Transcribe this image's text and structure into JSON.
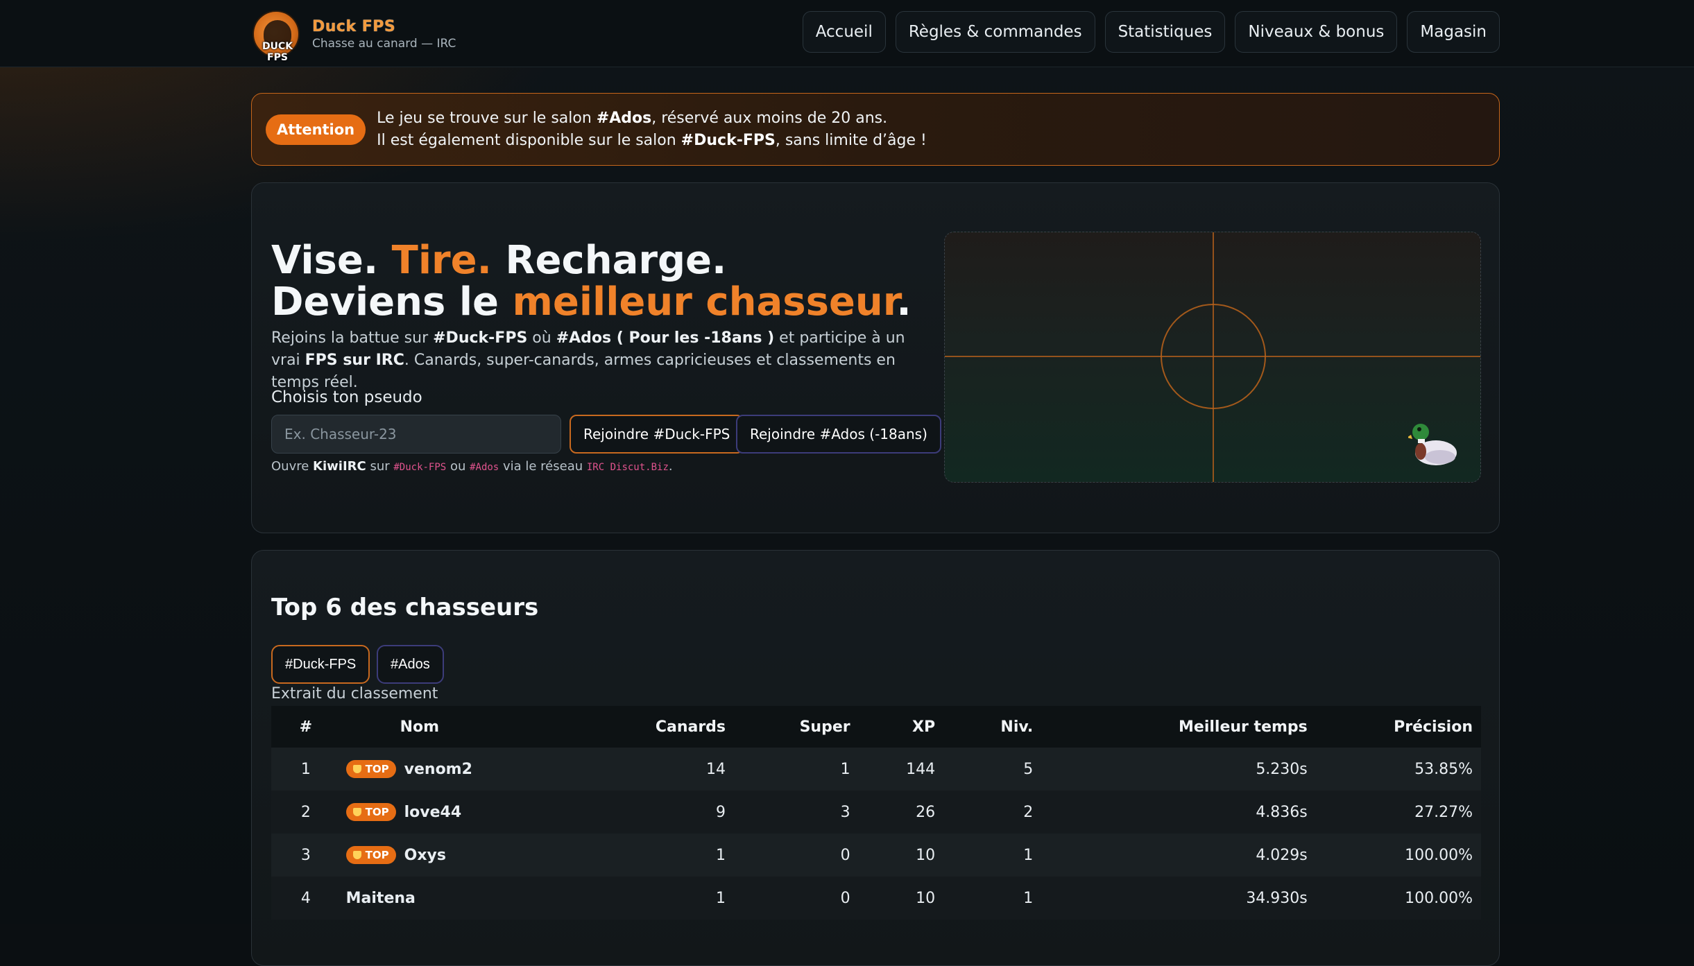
{
  "brand": {
    "logo_text": "DUCK FPS",
    "title": "Duck FPS",
    "subtitle": "Chasse au canard — IRC"
  },
  "nav": [
    {
      "label": "Accueil"
    },
    {
      "label": "Règles & commandes"
    },
    {
      "label": "Statistiques"
    },
    {
      "label": "Niveaux & bonus"
    },
    {
      "label": "Magasin"
    }
  ],
  "alert": {
    "badge": "Attention",
    "line1_pre": "Le jeu se trouve sur le salon ",
    "line1_bold": "#Ados",
    "line1_post": ", réservé aux moins de 20 ans.",
    "line2_pre": "Il est également disponible sur le salon ",
    "line2_bold": "#Duck-FPS",
    "line2_post": ", sans limite d’âge !"
  },
  "hero": {
    "t1": "Vise. ",
    "t1_accent": "Tire.",
    "t1_tail": " Recharge.",
    "t2": "Deviens le ",
    "t2_accent": "meilleur chasseur",
    "t2_tail": ".",
    "desc_1": "Rejoins la battue sur ",
    "desc_b1": "#Duck-FPS",
    "desc_2": " où ",
    "desc_b2": "#Ados ( Pour les -18ans )",
    "desc_3": " et participe à un vrai ",
    "desc_b3": "FPS sur IRC",
    "desc_4": ". Canards, super-canards, armes capricieuses et classements en temps réel.",
    "pseudo_label": "Choisis ton pseudo",
    "pseudo_placeholder": "Ex. Chasseur-23",
    "join_duck": "Rejoindre #Duck-FPS",
    "join_ados": "Rejoindre #Ados (-18ans)",
    "hint_1": "Ouvre ",
    "hint_b": "KiwiIRC",
    "hint_2": " sur ",
    "hint_c1": "#Duck-FPS",
    "hint_3": " ou ",
    "hint_c2": "#Ados",
    "hint_4": " via le réseau ",
    "hint_c3": "IRC Discut.Biz",
    "hint_5": "."
  },
  "board": {
    "title": "Top 6 des chasseurs",
    "tabs": [
      {
        "label": "#Duck-FPS"
      },
      {
        "label": "#Ados"
      }
    ],
    "extract": "Extrait du classement",
    "columns": [
      "#",
      "Nom",
      "Canards",
      "Super",
      "XP",
      "Niv.",
      "Meilleur temps",
      "Précision"
    ],
    "top_label": "TOP",
    "rows": [
      {
        "rank": "1",
        "name": "venom2",
        "top": true,
        "canards": "14",
        "super": "1",
        "xp": "144",
        "niv": "5",
        "temps": "5.230s",
        "precision": "53.85%"
      },
      {
        "rank": "2",
        "name": "love44",
        "top": true,
        "canards": "9",
        "super": "3",
        "xp": "26",
        "niv": "2",
        "temps": "4.836s",
        "precision": "27.27%"
      },
      {
        "rank": "3",
        "name": "Oxys",
        "top": true,
        "canards": "1",
        "super": "0",
        "xp": "10",
        "niv": "1",
        "temps": "4.029s",
        "precision": "100.00%"
      },
      {
        "rank": "4",
        "name": "Maitena",
        "top": false,
        "canards": "1",
        "super": "0",
        "xp": "10",
        "niv": "1",
        "temps": "34.930s",
        "precision": "100.00%"
      }
    ]
  },
  "colors": {
    "accent": "#f0822a",
    "badge": "#e66d14",
    "ados_border": "#3c3c7a"
  }
}
